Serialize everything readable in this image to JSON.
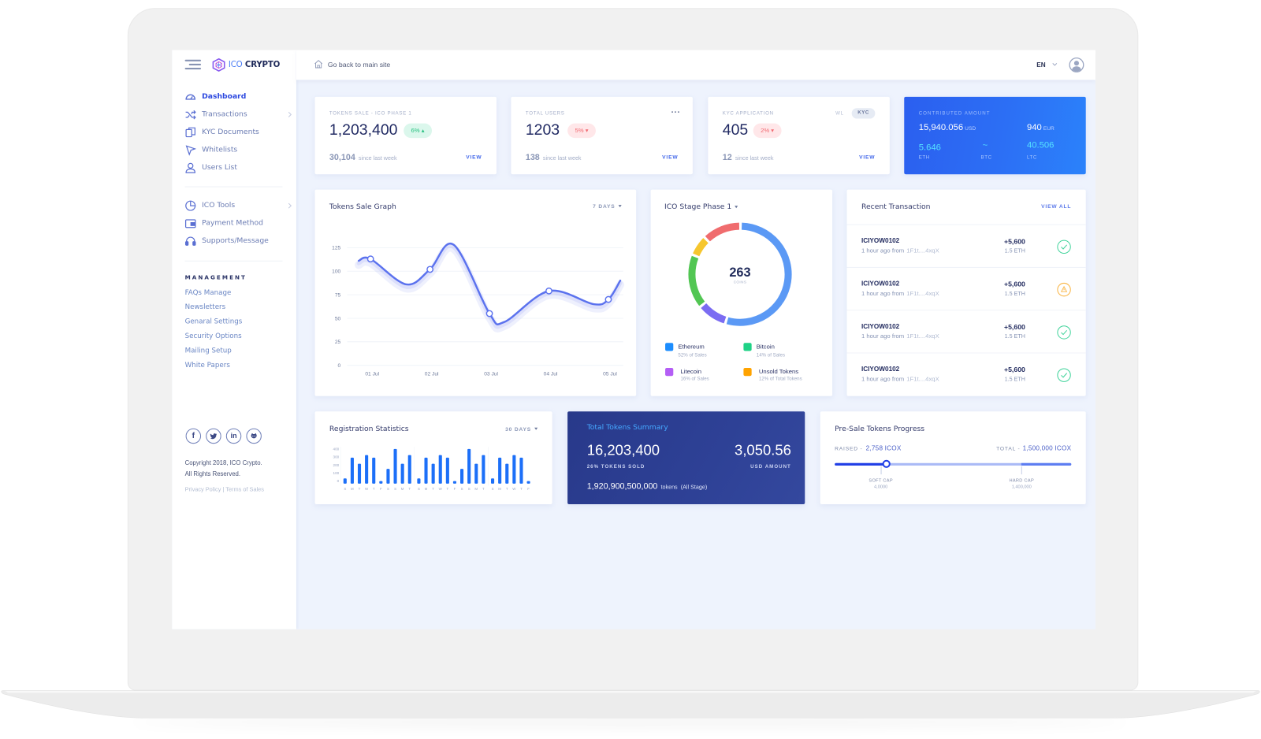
{
  "brand": {
    "prefix": "ICO",
    "suffix": "CRYPTO"
  },
  "header": {
    "back_link": "Go back to main site",
    "language": "EN"
  },
  "sidebar": {
    "nav_primary": [
      {
        "label": "Dashboard",
        "icon": "dashboard-icon",
        "active": true
      },
      {
        "label": "Transactions",
        "icon": "shuffle-icon",
        "has_submenu": true
      },
      {
        "label": "KYC Documents",
        "icon": "documents-icon"
      },
      {
        "label": "Whitelists",
        "icon": "cursor-icon"
      },
      {
        "label": "Users List",
        "icon": "user-icon"
      }
    ],
    "nav_tools": [
      {
        "label": "ICO Tools",
        "icon": "pie-chart-icon",
        "has_submenu": true
      },
      {
        "label": "Payment Method",
        "icon": "wallet-icon"
      },
      {
        "label": "Supports/Message",
        "icon": "headset-icon"
      }
    ],
    "management_heading": "MANAGEMENT",
    "management_items": [
      "FAQs Manage",
      "Newsletters",
      "Genaral Settings",
      "Security Options",
      "Mailing Setup",
      "White Papers"
    ],
    "social": [
      {
        "name": "facebook",
        "glyph": "f"
      },
      {
        "name": "twitter",
        "glyph": ""
      },
      {
        "name": "linkedin",
        "glyph": "in"
      },
      {
        "name": "github",
        "glyph": ""
      }
    ],
    "copyright": "Copyright 2018, ICO Crypto.",
    "rights": "All Rights Reserved.",
    "footer_links": {
      "privacy": "Privacy Policy",
      "separator": " | ",
      "terms": "Terms of Sales"
    }
  },
  "stats": [
    {
      "label": "TOKENS SALE - ICO PHASE 1",
      "value": "1,203,400",
      "badge": "6% ▴",
      "trend": "up",
      "since_value": "30,104",
      "since_label": "since last week",
      "action": "VIEW"
    },
    {
      "label": "TOTAL USERS",
      "value": "1203",
      "badge": "5% ▾",
      "trend": "down",
      "since_value": "138",
      "since_label": "since last week",
      "action": "VIEW",
      "menu": "•••"
    },
    {
      "label": "KYC APPLICATION",
      "value": "405",
      "badge": "2% ▾",
      "trend": "down",
      "since_value": "12",
      "since_label": "since last week",
      "action": "VIEW",
      "tabs": [
        "WL",
        "KYC"
      ],
      "active_tab": "KYC"
    }
  ],
  "contributed": {
    "label": "CONTRIBUTED AMOUNT",
    "usd": "15,940.056",
    "usd_unit": "USD",
    "eur": "940",
    "eur_unit": "EUR",
    "eth": "5.646",
    "eth_unit": "ETH",
    "btc": "~",
    "btc_unit": "BTC",
    "ltc": "40.506",
    "ltc_unit": "LTC"
  },
  "tokens_sale_graph": {
    "title": "Tokens Sale Graph",
    "range": "7 DAYS"
  },
  "ico_stage": {
    "title": "ICO Stage Phase 1",
    "center_value": "263",
    "center_label": "COINS"
  },
  "recent_transactions": {
    "title": "Recent Transaction",
    "view_all": "VIEW ALL",
    "items": [
      {
        "id": "ICIYOW0102",
        "time": "1 hour ago from",
        "address": "1F1t....4xqX",
        "amount": "+5,600",
        "eth": "1.5 ETH",
        "status": "success"
      },
      {
        "id": "ICIYOW0102",
        "time": "1 hour ago from",
        "address": "1F1t....4xqX",
        "amount": "+5,600",
        "eth": "1.5 ETH",
        "status": "warning"
      },
      {
        "id": "ICIYOW0102",
        "time": "1 hour ago from",
        "address": "1F1t....4xqX",
        "amount": "+5,600",
        "eth": "1.5 ETH",
        "status": "success"
      },
      {
        "id": "ICIYOW0102",
        "time": "1 hour ago from",
        "address": "1F1t....4xqX",
        "amount": "+5,600",
        "eth": "1.5 ETH",
        "status": "success"
      }
    ]
  },
  "registration": {
    "title": "Registration Statistics",
    "range": "30 DAYS"
  },
  "summary": {
    "title": "Total Tokens Summary",
    "tokens": "16,203,400",
    "tokens_label": "26% TOKENS SOLD",
    "usd": "3,050.56",
    "usd_label": "USD AMOUNT",
    "all_stage_value": "1,920,900,500,000",
    "all_stage_unit": "tokens",
    "all_stage_note": "(All Stage)"
  },
  "presale": {
    "title": "Pre-Sale Tokens Progress",
    "raised_label": "RAISED -",
    "raised_value": "2,758 ICOX",
    "total_label": "TOTAL -",
    "total_value": "1,500,000 ICOX",
    "progress_fraction": 0.22,
    "soft_cap": {
      "label": "SOFT CAP",
      "value": "4,0000",
      "position_fraction": 0.195
    },
    "hard_cap": {
      "label": "HARD CAP",
      "value": "1,400,000",
      "position_fraction": 0.79
    }
  },
  "colors": {
    "accent": "#2c48df",
    "background": "#eef3fd",
    "navy_text": "#212a63",
    "badge_up": "#26c07f",
    "badge_down": "#f26a72",
    "contributed_card": "#2c6ff5",
    "summary_card": "#2e4196",
    "status_success": "#3fd39a",
    "status_warning": "#f9b544"
  },
  "chart_data": [
    {
      "type": "line",
      "title": "Tokens Sale Graph",
      "categories": [
        "01 Jul",
        "02 Jul",
        "03 Jul",
        "04 Jul",
        "05 Jul"
      ],
      "values": [
        113,
        102,
        55,
        79,
        70
      ],
      "curve_points": [
        [
          -0.2,
          111
        ],
        [
          0,
          113
        ],
        [
          0.6,
          86
        ],
        [
          1,
          102
        ],
        [
          1.4,
          128
        ],
        [
          2,
          55
        ],
        [
          2.25,
          46
        ],
        [
          3,
          79
        ],
        [
          3.75,
          65
        ],
        [
          4,
          70
        ],
        [
          4.2,
          90
        ]
      ],
      "yticks": [
        0,
        25,
        50,
        75,
        100,
        125
      ],
      "ylim": [
        0,
        125
      ],
      "xlabel": "",
      "ylabel": "",
      "grid": true,
      "color": "#5b72ee"
    },
    {
      "type": "pie",
      "title": "ICO Stage Phase 1",
      "donut": true,
      "center_text": "263",
      "center_subtext": "COINS",
      "segments": [
        {
          "color": "#5b99f5",
          "value": 56
        },
        {
          "color": "#7b6cf2",
          "value": 9
        },
        {
          "color": "#52c653",
          "value": 17
        },
        {
          "color": "#f6c62e",
          "value": 6
        },
        {
          "color": "#f06c6e",
          "value": 12
        }
      ],
      "legend": [
        {
          "name": "Ethereum",
          "sub": "52% of Sales",
          "color": "#1c8dfe"
        },
        {
          "name": "Bitcoin",
          "sub": "14% of Sales",
          "color": "#1fd286"
        },
        {
          "name": "Litecoin",
          "sub": "16% of Sales",
          "color": "#b45ef5"
        },
        {
          "name": "Unsold Tokens",
          "sub": "12% of Total Tokens",
          "color": "#ffa300"
        }
      ]
    },
    {
      "type": "bar",
      "title": "Registration Statistics",
      "categories": [
        "S",
        "M",
        "T",
        "W",
        "T",
        "F",
        "S",
        "S",
        "M",
        "T",
        "S",
        "M",
        "T",
        "W",
        "T",
        "F",
        "S",
        "S",
        "M",
        "T",
        "S",
        "M",
        "T",
        "W",
        "T",
        "F"
      ],
      "values": [
        60,
        300,
        230,
        330,
        300,
        30,
        170,
        400,
        230,
        330,
        60,
        300,
        230,
        330,
        300,
        30,
        170,
        400,
        230,
        330,
        60,
        300,
        230,
        330,
        300,
        30
      ],
      "yticks": [
        0,
        100,
        200,
        300,
        400
      ],
      "ylim": [
        0,
        400
      ],
      "color": "#1c6ff8"
    }
  ]
}
